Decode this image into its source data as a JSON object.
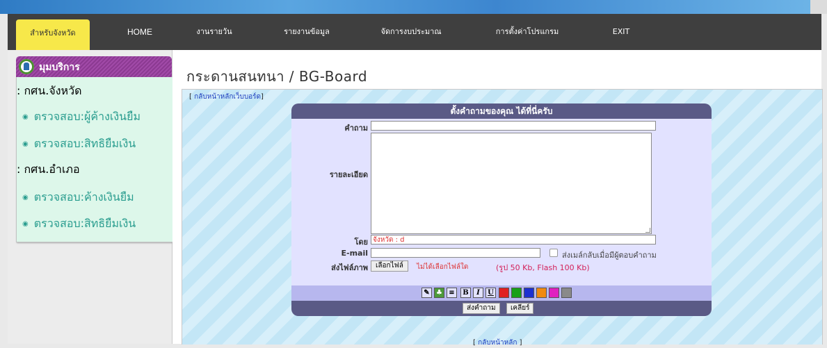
{
  "nav": {
    "items": [
      {
        "label": "สำหรับจังหวัด",
        "active": true
      },
      {
        "label": "HOME"
      },
      {
        "label": "งานรายวัน"
      },
      {
        "label": "รายงานข้อมูล"
      },
      {
        "label": "จัดการงบประมาณ"
      },
      {
        "label": "การตั้งค่าโปรแกรม"
      },
      {
        "label": "EXIT"
      }
    ]
  },
  "sidebar": {
    "title": "มุมบริการ",
    "groups": [
      {
        "label": ": กศน.จังหวัด",
        "links": [
          "ตรวจสอบ:ผู้ค้างเงินยืม",
          "ตรวจสอบ:สิทธิยืมเงิน"
        ]
      },
      {
        "label": ": กศน.อำเภอ",
        "links": [
          "ตรวจสอบ:ค้างเงินยืม",
          "ตรวจสอบ:สิทธิยืมเงิน"
        ]
      }
    ]
  },
  "main": {
    "title": "กระดานสนทนา / BG-Board",
    "back_top": {
      "open": "[ ",
      "link": "กลับหน้าหลักเว็บบอร์ด",
      "close": "]"
    },
    "back_bottom": {
      "open": "[ ",
      "link": "กลับหน้าหลัก",
      "close": " ]"
    },
    "form": {
      "header": "ตั้งคำถามของคุณ ได้ที่นี่ครับ",
      "question_label": "คำถาม",
      "question_value": "",
      "detail_label": "รายละเอียด",
      "detail_value": "",
      "by_label": "โดย",
      "by_value": "จังหวัด : d",
      "email_label": "E-mail",
      "email_value": "",
      "notify_label": "ส่งเมล์กลับเมื่อมีผู้ตอบคำถาม",
      "notify_checked": false,
      "image_label": "ส่งไฟล์ภาพ",
      "choose_file": "เลือกไฟล์",
      "no_file": "ไม่ได้เลือกไฟล์ใด",
      "size_note": "(รูป 50 Kb, Flash 100 Kb)",
      "toolbar": [
        {
          "icon": "link-icon",
          "glyph": "✎",
          "bg": "#e2e2ff"
        },
        {
          "icon": "picture-icon",
          "glyph": "♣",
          "bg": "#4c9a3a"
        },
        {
          "icon": "list-icon",
          "glyph": "≡",
          "bg": "#e2e2ff"
        },
        {
          "icon": "bold-icon",
          "glyph": "B",
          "bg": "#e2e2ff"
        },
        {
          "icon": "italic-icon",
          "glyph": "I",
          "bg": "#e2e2ff"
        },
        {
          "icon": "underline-icon",
          "glyph": "U",
          "bg": "#e2e2ff"
        },
        {
          "icon": "color-red-icon",
          "glyph": "",
          "bg": "#e02020"
        },
        {
          "icon": "color-green-icon",
          "glyph": "",
          "bg": "#18a018"
        },
        {
          "icon": "color-blue-icon",
          "glyph": "",
          "bg": "#1c2fd0"
        },
        {
          "icon": "color-orange-icon",
          "glyph": "",
          "bg": "#f08a10"
        },
        {
          "icon": "color-pink-icon",
          "glyph": "",
          "bg": "#e020c0"
        },
        {
          "icon": "color-gray-icon",
          "glyph": "",
          "bg": "#8a8a8a"
        }
      ],
      "submit_label": "ส่งคำถาม",
      "clear_label": "เคลียร์"
    }
  }
}
